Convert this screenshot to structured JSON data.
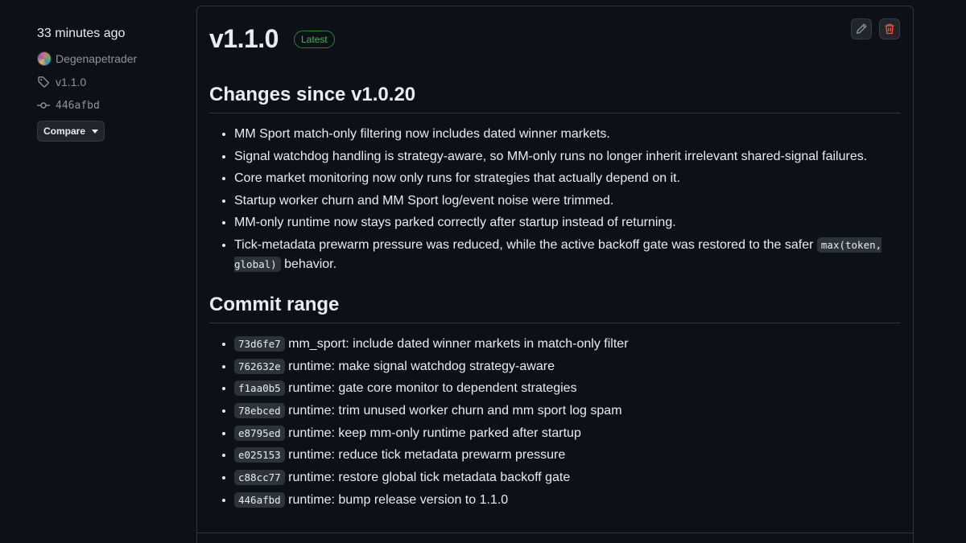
{
  "sidebar": {
    "time": "33 minutes ago",
    "author": "Degenapetrader",
    "tag": "v1.1.0",
    "commit": "446afbd",
    "compare_label": "Compare"
  },
  "release": {
    "title": "v1.1.0",
    "badge": "Latest",
    "changes_heading": "Changes since v1.0.20",
    "changes": [
      "MM Sport match-only filtering now includes dated winner markets.",
      "Signal watchdog handling is strategy-aware, so MM-only runs no longer inherit irrelevant shared-signal failures.",
      "Core market monitoring now only runs for strategies that actually depend on it.",
      "Startup worker churn and MM Sport log/event noise were trimmed.",
      "MM-only runtime now stays parked correctly after startup instead of returning."
    ],
    "change_last": {
      "before": "Tick-metadata prewarm pressure was reduced, while the active backoff gate was restored to the safer ",
      "code": "max(token, global)",
      "after": " behavior."
    },
    "commits_heading": "Commit range",
    "commits": [
      {
        "sha": "73d6fe7",
        "message": "mm_sport: include dated winner markets in match-only filter"
      },
      {
        "sha": "762632e",
        "message": "runtime: make signal watchdog strategy-aware"
      },
      {
        "sha": "f1aa0b5",
        "message": "runtime: gate core monitor to dependent strategies"
      },
      {
        "sha": "78ebced",
        "message": "runtime: trim unused worker churn and mm sport log spam"
      },
      {
        "sha": "e8795ed",
        "message": "runtime: keep mm-only runtime parked after startup"
      },
      {
        "sha": "e025153",
        "message": "runtime: reduce tick metadata prewarm pressure"
      },
      {
        "sha": "c88cc77",
        "message": "runtime: restore global tick metadata backoff gate"
      },
      {
        "sha": "446afbd",
        "message": "runtime: bump release version to 1.1.0"
      }
    ]
  },
  "icons": {
    "avatar": "avatar",
    "tag": "tag-icon",
    "commit": "git-commit-icon",
    "edit": "pencil-icon",
    "delete": "trash-icon"
  },
  "colors": {
    "background": "#0d1117",
    "text": "#e6edf3",
    "muted": "#8b949e",
    "border": "#30363d",
    "latest_green": "#3fb950",
    "danger_red": "#f85149"
  }
}
